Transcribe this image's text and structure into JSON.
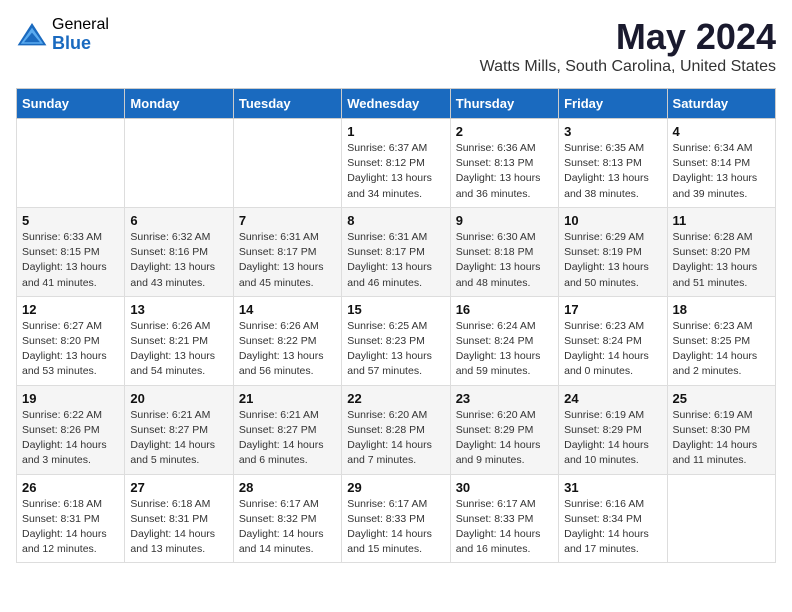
{
  "logo": {
    "general": "General",
    "blue": "Blue"
  },
  "title": "May 2024",
  "subtitle": "Watts Mills, South Carolina, United States",
  "headers": [
    "Sunday",
    "Monday",
    "Tuesday",
    "Wednesday",
    "Thursday",
    "Friday",
    "Saturday"
  ],
  "weeks": [
    [
      {
        "day": "",
        "info": ""
      },
      {
        "day": "",
        "info": ""
      },
      {
        "day": "",
        "info": ""
      },
      {
        "day": "1",
        "info": "Sunrise: 6:37 AM\nSunset: 8:12 PM\nDaylight: 13 hours\nand 34 minutes."
      },
      {
        "day": "2",
        "info": "Sunrise: 6:36 AM\nSunset: 8:13 PM\nDaylight: 13 hours\nand 36 minutes."
      },
      {
        "day": "3",
        "info": "Sunrise: 6:35 AM\nSunset: 8:13 PM\nDaylight: 13 hours\nand 38 minutes."
      },
      {
        "day": "4",
        "info": "Sunrise: 6:34 AM\nSunset: 8:14 PM\nDaylight: 13 hours\nand 39 minutes."
      }
    ],
    [
      {
        "day": "5",
        "info": "Sunrise: 6:33 AM\nSunset: 8:15 PM\nDaylight: 13 hours\nand 41 minutes."
      },
      {
        "day": "6",
        "info": "Sunrise: 6:32 AM\nSunset: 8:16 PM\nDaylight: 13 hours\nand 43 minutes."
      },
      {
        "day": "7",
        "info": "Sunrise: 6:31 AM\nSunset: 8:17 PM\nDaylight: 13 hours\nand 45 minutes."
      },
      {
        "day": "8",
        "info": "Sunrise: 6:31 AM\nSunset: 8:17 PM\nDaylight: 13 hours\nand 46 minutes."
      },
      {
        "day": "9",
        "info": "Sunrise: 6:30 AM\nSunset: 8:18 PM\nDaylight: 13 hours\nand 48 minutes."
      },
      {
        "day": "10",
        "info": "Sunrise: 6:29 AM\nSunset: 8:19 PM\nDaylight: 13 hours\nand 50 minutes."
      },
      {
        "day": "11",
        "info": "Sunrise: 6:28 AM\nSunset: 8:20 PM\nDaylight: 13 hours\nand 51 minutes."
      }
    ],
    [
      {
        "day": "12",
        "info": "Sunrise: 6:27 AM\nSunset: 8:20 PM\nDaylight: 13 hours\nand 53 minutes."
      },
      {
        "day": "13",
        "info": "Sunrise: 6:26 AM\nSunset: 8:21 PM\nDaylight: 13 hours\nand 54 minutes."
      },
      {
        "day": "14",
        "info": "Sunrise: 6:26 AM\nSunset: 8:22 PM\nDaylight: 13 hours\nand 56 minutes."
      },
      {
        "day": "15",
        "info": "Sunrise: 6:25 AM\nSunset: 8:23 PM\nDaylight: 13 hours\nand 57 minutes."
      },
      {
        "day": "16",
        "info": "Sunrise: 6:24 AM\nSunset: 8:24 PM\nDaylight: 13 hours\nand 59 minutes."
      },
      {
        "day": "17",
        "info": "Sunrise: 6:23 AM\nSunset: 8:24 PM\nDaylight: 14 hours\nand 0 minutes."
      },
      {
        "day": "18",
        "info": "Sunrise: 6:23 AM\nSunset: 8:25 PM\nDaylight: 14 hours\nand 2 minutes."
      }
    ],
    [
      {
        "day": "19",
        "info": "Sunrise: 6:22 AM\nSunset: 8:26 PM\nDaylight: 14 hours\nand 3 minutes."
      },
      {
        "day": "20",
        "info": "Sunrise: 6:21 AM\nSunset: 8:27 PM\nDaylight: 14 hours\nand 5 minutes."
      },
      {
        "day": "21",
        "info": "Sunrise: 6:21 AM\nSunset: 8:27 PM\nDaylight: 14 hours\nand 6 minutes."
      },
      {
        "day": "22",
        "info": "Sunrise: 6:20 AM\nSunset: 8:28 PM\nDaylight: 14 hours\nand 7 minutes."
      },
      {
        "day": "23",
        "info": "Sunrise: 6:20 AM\nSunset: 8:29 PM\nDaylight: 14 hours\nand 9 minutes."
      },
      {
        "day": "24",
        "info": "Sunrise: 6:19 AM\nSunset: 8:29 PM\nDaylight: 14 hours\nand 10 minutes."
      },
      {
        "day": "25",
        "info": "Sunrise: 6:19 AM\nSunset: 8:30 PM\nDaylight: 14 hours\nand 11 minutes."
      }
    ],
    [
      {
        "day": "26",
        "info": "Sunrise: 6:18 AM\nSunset: 8:31 PM\nDaylight: 14 hours\nand 12 minutes."
      },
      {
        "day": "27",
        "info": "Sunrise: 6:18 AM\nSunset: 8:31 PM\nDaylight: 14 hours\nand 13 minutes."
      },
      {
        "day": "28",
        "info": "Sunrise: 6:17 AM\nSunset: 8:32 PM\nDaylight: 14 hours\nand 14 minutes."
      },
      {
        "day": "29",
        "info": "Sunrise: 6:17 AM\nSunset: 8:33 PM\nDaylight: 14 hours\nand 15 minutes."
      },
      {
        "day": "30",
        "info": "Sunrise: 6:17 AM\nSunset: 8:33 PM\nDaylight: 14 hours\nand 16 minutes."
      },
      {
        "day": "31",
        "info": "Sunrise: 6:16 AM\nSunset: 8:34 PM\nDaylight: 14 hours\nand 17 minutes."
      },
      {
        "day": "",
        "info": ""
      }
    ]
  ]
}
